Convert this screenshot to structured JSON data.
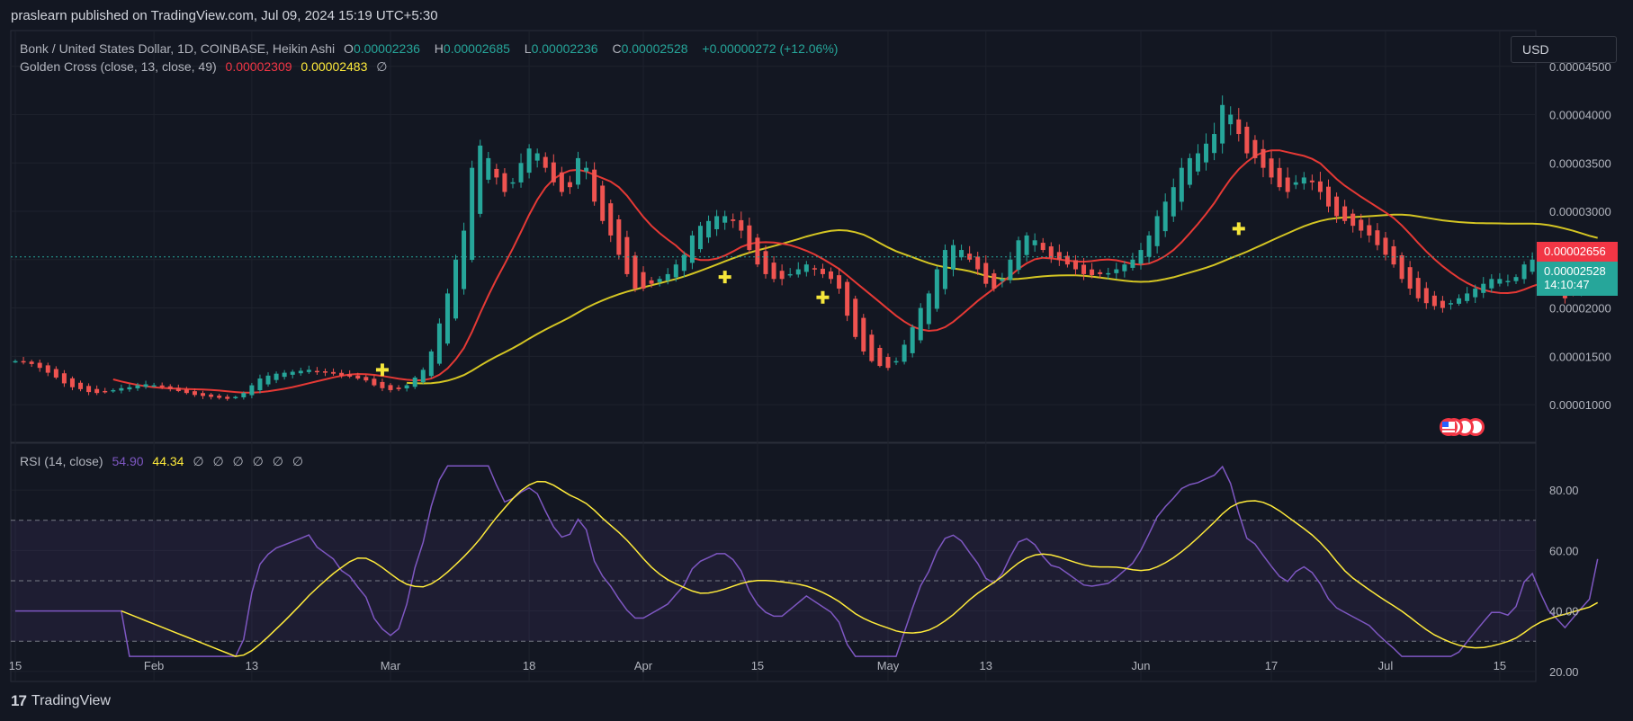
{
  "publish_line": "praslearn published on TradingView.com, Jul 09, 2024 15:19 UTC+5:30",
  "symbol": {
    "name": "Bonk / United States Dollar, 1D, COINBASE, Heikin Ashi",
    "o_label": "O",
    "o_value": "0.00002236",
    "h_label": "H",
    "h_value": "0.00002685",
    "l_label": "L",
    "l_value": "0.00002236",
    "c_label": "C",
    "c_value": "0.00002528",
    "change": "+0.00000272 (+12.06%)"
  },
  "golden_cross": {
    "label": "Golden Cross (close, 13, close, 49)",
    "fast": "0.00002309",
    "slow": "0.00002483",
    "eye": "∅"
  },
  "rsi_legend": {
    "label": "RSI (14, close)",
    "value": "54.90",
    "ma": "44.34",
    "hidden": [
      "∅",
      "∅",
      "∅",
      "∅",
      "∅",
      "∅"
    ]
  },
  "currency_button": "USD",
  "price_tags": {
    "ma_fast": "0.00002656",
    "last": "0.00002528",
    "countdown": "14:10:47"
  },
  "footer_brand": "TradingView",
  "colors": {
    "up": "#26a69a",
    "down": "#ef5350",
    "ema_fast": "#e53935",
    "ema_slow": "#d4c523",
    "rsi": "#7e57c2",
    "rsi_ma": "#ffeb3b",
    "cross": "#f5e63b"
  },
  "chart_data": [
    {
      "type": "candlestick",
      "title": "Bonk / United States Dollar, 1D, COINBASE, Heikin Ashi",
      "y_ticks": [
        "0.00004500",
        "0.00004000",
        "0.00003500",
        "0.00003000",
        "0.00002500",
        "0.00002000",
        "0.00001500",
        "0.00001000"
      ],
      "ylim": [
        6.1e-06,
        4.87e-05
      ],
      "x_ticks": [
        "15",
        "Feb",
        "13",
        "Mar",
        "18",
        "Apr",
        "15",
        "May",
        "13",
        "Jun",
        "17",
        "Jul",
        "15"
      ],
      "x_tick_dates": [
        "2024-01-15",
        "2024-02-01",
        "2024-02-13",
        "2024-03-01",
        "2024-03-18",
        "2024-04-01",
        "2024-04-15",
        "2024-05-01",
        "2024-05-13",
        "2024-06-01",
        "2024-06-17",
        "2024-07-01",
        "2024-07-15"
      ],
      "ohlc_series": {
        "start_date": "2024-01-15",
        "close": [
          1.45,
          1.44,
          1.42,
          1.38,
          1.33,
          1.28,
          1.22,
          1.18,
          1.16,
          1.13,
          1.12,
          1.14,
          1.15,
          1.17,
          1.18,
          1.2,
          1.21,
          1.2,
          1.18,
          1.16,
          1.14,
          1.12,
          1.1,
          1.09,
          1.08,
          1.07,
          1.06,
          1.08,
          1.12,
          1.2,
          1.27,
          1.3,
          1.32,
          1.33,
          1.34,
          1.35,
          1.36,
          1.34,
          1.33,
          1.32,
          1.3,
          1.29,
          1.27,
          1.25,
          1.2,
          1.17,
          1.15,
          1.16,
          1.2,
          1.28,
          1.36,
          1.55,
          1.84,
          2.15,
          2.5,
          2.8,
          3.45,
          3.68,
          3.55,
          3.35,
          3.2,
          3.3,
          3.5,
          3.65,
          3.6,
          3.45,
          3.3,
          3.2,
          3.25,
          3.55,
          3.45,
          3.1,
          2.9,
          2.75,
          2.55,
          2.35,
          2.2,
          2.2,
          2.25,
          2.3,
          2.35,
          2.45,
          2.55,
          2.75,
          2.85,
          2.9,
          2.95,
          2.95,
          2.9,
          2.8,
          2.6,
          2.45,
          2.35,
          2.3,
          2.3,
          2.35,
          2.4,
          2.45,
          2.4,
          2.35,
          2.3,
          2.2,
          1.92,
          1.7,
          1.55,
          1.45,
          1.4,
          1.38,
          1.45,
          1.62,
          1.8,
          2.0,
          2.15,
          2.4,
          2.6,
          2.65,
          2.6,
          2.5,
          2.4,
          2.25,
          2.2,
          2.3,
          2.5,
          2.7,
          2.75,
          2.7,
          2.6,
          2.52,
          2.5,
          2.45,
          2.4,
          2.35,
          2.34,
          2.35,
          2.36,
          2.4,
          2.45,
          2.5,
          2.6,
          2.75,
          2.95,
          3.1,
          3.25,
          3.45,
          3.55,
          3.6,
          3.7,
          3.8,
          4.1,
          4.0,
          3.8,
          3.6,
          3.55,
          3.45,
          3.35,
          3.25,
          3.2,
          3.3,
          3.35,
          3.3,
          3.2,
          3.05,
          2.95,
          2.9,
          2.85,
          2.8,
          2.75,
          2.65,
          2.55,
          2.45,
          2.3,
          2.2,
          2.1,
          2.05,
          2.02,
          2.0,
          2.05,
          2.1,
          2.15,
          2.2,
          2.25,
          2.3,
          2.3,
          2.28,
          2.32,
          2.45,
          2.5,
          2.38,
          2.25,
          2.18,
          2.1,
          2.15,
          2.2,
          2.25,
          2.528
        ]
      },
      "series": [
        {
          "name": "Golden Cross fast MA (13)",
          "last": 2.309e-05
        },
        {
          "name": "Golden Cross slow MA (49)",
          "last": 2.483e-05
        }
      ],
      "last_price": 2.528e-05,
      "crosses": [
        {
          "date": "2024-02-29",
          "value": 1.36e-05
        },
        {
          "date": "2024-04-11",
          "value": 2.32e-05
        },
        {
          "date": "2024-04-23",
          "value": 2.11e-05
        },
        {
          "date": "2024-06-13",
          "value": 2.82e-05
        }
      ]
    },
    {
      "type": "line",
      "title": "RSI (14, close)",
      "y_ticks": [
        "80.00",
        "60.00",
        "40.00",
        "20.00"
      ],
      "ylim": [
        16.7,
        95.5
      ],
      "levels": [
        70,
        50,
        30
      ],
      "series": [
        {
          "name": "RSI",
          "last": 54.9
        },
        {
          "name": "RSI MA",
          "last": 44.34
        }
      ]
    }
  ]
}
